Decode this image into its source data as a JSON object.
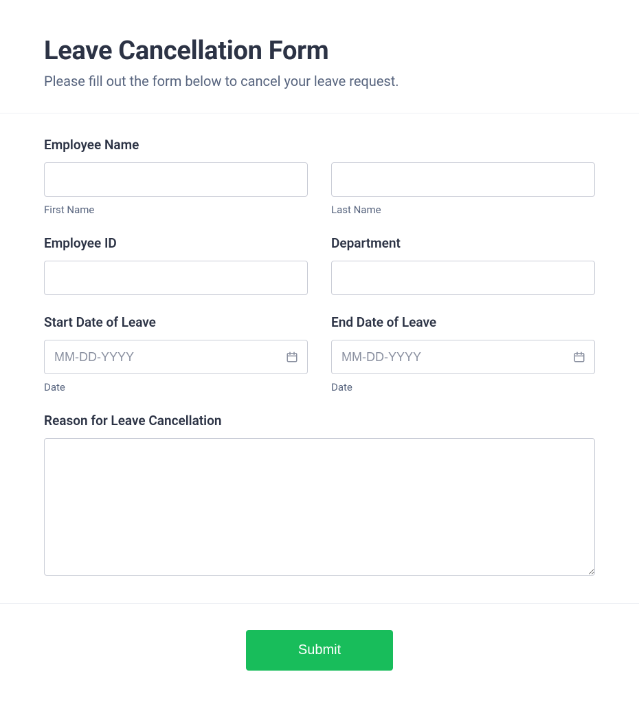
{
  "header": {
    "title": "Leave Cancellation Form",
    "subtitle": "Please fill out the form below to cancel your leave request."
  },
  "form": {
    "employee_name": {
      "label": "Employee Name",
      "first": {
        "value": "",
        "sublabel": "First Name"
      },
      "last": {
        "value": "",
        "sublabel": "Last Name"
      }
    },
    "employee_id": {
      "label": "Employee ID",
      "value": ""
    },
    "department": {
      "label": "Department",
      "value": ""
    },
    "start_date": {
      "label": "Start Date of Leave",
      "placeholder": "MM-DD-YYYY",
      "value": "",
      "sublabel": "Date"
    },
    "end_date": {
      "label": "End Date of Leave",
      "placeholder": "MM-DD-YYYY",
      "value": "",
      "sublabel": "Date"
    },
    "reason": {
      "label": "Reason for Leave Cancellation",
      "value": ""
    }
  },
  "footer": {
    "submit_label": "Submit"
  }
}
